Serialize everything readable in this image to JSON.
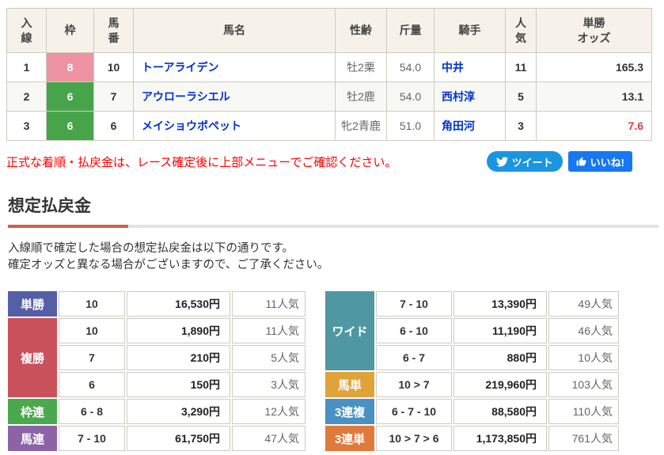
{
  "results": {
    "headers": [
      "入\n線",
      "枠",
      "馬\n番",
      "馬名",
      "性齢",
      "斤量",
      "騎手",
      "人\n気",
      "単勝\nオッズ"
    ],
    "rows": [
      {
        "pos": "1",
        "frame": "8",
        "frame_color": "#ed93a1",
        "num": "10",
        "name": "トーアライデン",
        "sex_age": "牡2栗",
        "weight": "54.0",
        "jockey": "中井",
        "popularity": "11",
        "odds": "165.3",
        "odds_color": "#333333"
      },
      {
        "pos": "2",
        "frame": "6",
        "frame_color": "#47a44b",
        "num": "7",
        "name": "アウローラシエル",
        "sex_age": "牡2鹿",
        "weight": "54.0",
        "jockey": "西村淳",
        "popularity": "5",
        "odds": "13.1",
        "odds_color": "#333333"
      },
      {
        "pos": "3",
        "frame": "6",
        "frame_color": "#47a44b",
        "num": "6",
        "name": "メイショウポペット",
        "sex_age": "牝2青鹿",
        "weight": "51.0",
        "jockey": "角田河",
        "popularity": "3",
        "odds": "7.6",
        "odds_color": "#e8383d"
      }
    ]
  },
  "notice": {
    "text": "正式な着順・払戻金は、レース確定後に上部メニューでご確認ください。",
    "color": "#ff0000"
  },
  "social": {
    "tweet_label": "ツイート",
    "tweet_color": "#1b95e0",
    "like_label": "いいね!",
    "like_color": "#1877f2"
  },
  "section": {
    "title": "想定払戻金",
    "accent_color": "#d65c4a"
  },
  "description": {
    "line1": "入線順で確定した場合の想定払戻金は以下の通りです。",
    "line2": "確定オッズと異なる場合がございますので、ご了承ください。"
  },
  "payouts_left": [
    {
      "label": "単勝",
      "color": "#555fa8",
      "rows": [
        {
          "combo": "10",
          "amount": "16,530円",
          "pop": "11人気"
        }
      ]
    },
    {
      "label": "複勝",
      "color": "#c9515c",
      "rows": [
        {
          "combo": "10",
          "amount": "1,890円",
          "pop": "11人気"
        },
        {
          "combo": "7",
          "amount": "210円",
          "pop": "5人気"
        },
        {
          "combo": "6",
          "amount": "150円",
          "pop": "3人気"
        }
      ]
    },
    {
      "label": "枠連",
      "color": "#4ba84f",
      "rows": [
        {
          "combo": "6 - 8",
          "amount": "3,290円",
          "pop": "12人気"
        }
      ]
    },
    {
      "label": "馬連",
      "color": "#8d63a8",
      "rows": [
        {
          "combo": "7 - 10",
          "amount": "61,750円",
          "pop": "47人気"
        }
      ]
    }
  ],
  "payouts_right": [
    {
      "label": "ワイド",
      "color": "#4f98a3",
      "rows": [
        {
          "combo": "7 - 10",
          "amount": "13,390円",
          "pop": "49人気"
        },
        {
          "combo": "6 - 10",
          "amount": "11,190円",
          "pop": "46人気"
        },
        {
          "combo": "6 - 7",
          "amount": "880円",
          "pop": "10人気"
        }
      ]
    },
    {
      "label": "馬単",
      "color": "#e0a33a",
      "rows": [
        {
          "combo": "10 > 7",
          "amount": "219,960円",
          "pop": "103人気"
        }
      ]
    },
    {
      "label": "3連複",
      "color": "#4a90c3",
      "rows": [
        {
          "combo": "6 - 7 - 10",
          "amount": "88,580円",
          "pop": "110人気"
        }
      ]
    },
    {
      "label": "3連単",
      "color": "#e0793c",
      "rows": [
        {
          "combo": "10 > 7 > 6",
          "amount": "1,173,850円",
          "pop": "761人気"
        }
      ]
    }
  ]
}
